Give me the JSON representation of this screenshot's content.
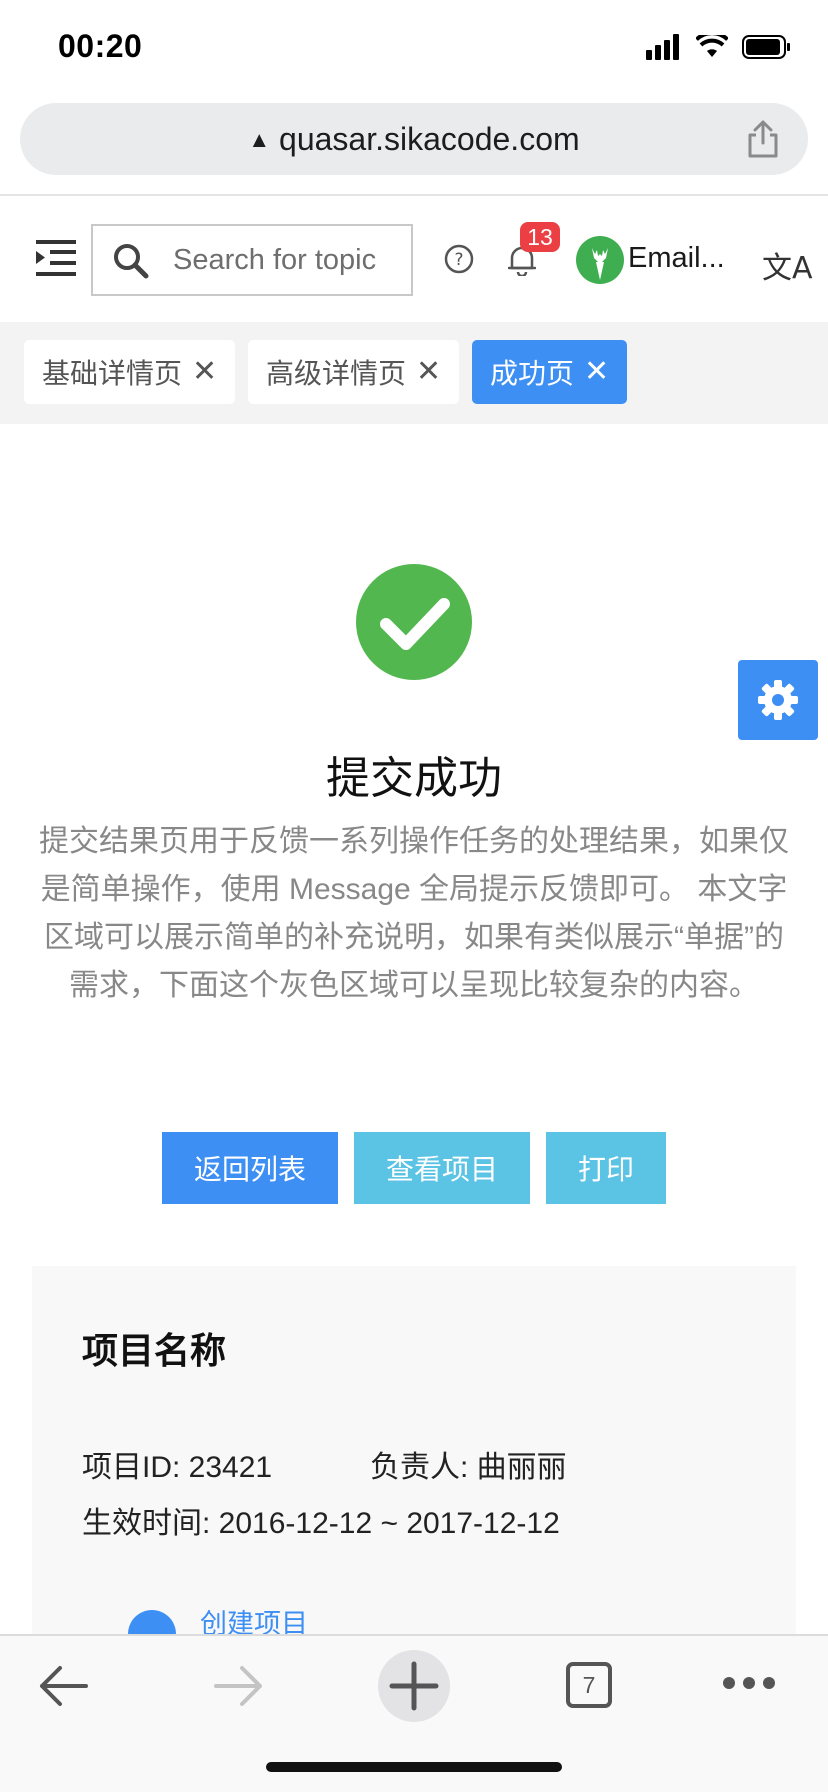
{
  "status_bar": {
    "time": "00:20"
  },
  "browser": {
    "url": "quasar.sikacode.com",
    "tab_count": "7"
  },
  "header": {
    "search_placeholder": "Search for topic",
    "notification_count": "13",
    "user_label": "Email..."
  },
  "tabs": [
    {
      "label": "基础详情页",
      "close": "✕"
    },
    {
      "label": "高级详情页",
      "close": "✕"
    },
    {
      "label": "成功页",
      "close": "✕",
      "active": true
    }
  ],
  "result": {
    "title": "提交成功",
    "description": "提交结果页用于反馈一系列操作任务的处理结果，如果仅是简单操作，使用 Message 全局提示反馈即可。 本文字区域可以展示简单的补充说明，如果有类似展示“单据”的需求，下面这个灰色区域可以呈现比较复杂的内容。",
    "actions": {
      "back_to_list": "返回列表",
      "view_project": "查看项目",
      "print": "打印"
    }
  },
  "detail": {
    "title": "项目名称",
    "project_id": "项目ID: 23421",
    "owner": "负责人: 曲丽丽",
    "effective_time": "生效时间: 2016-12-12 ~ 2017-12-12",
    "first_step": "创建项目"
  },
  "colors": {
    "primary": "#3d8ff3",
    "info": "#5bc3e4",
    "success": "#53b750",
    "badge": "#ec3f44"
  }
}
